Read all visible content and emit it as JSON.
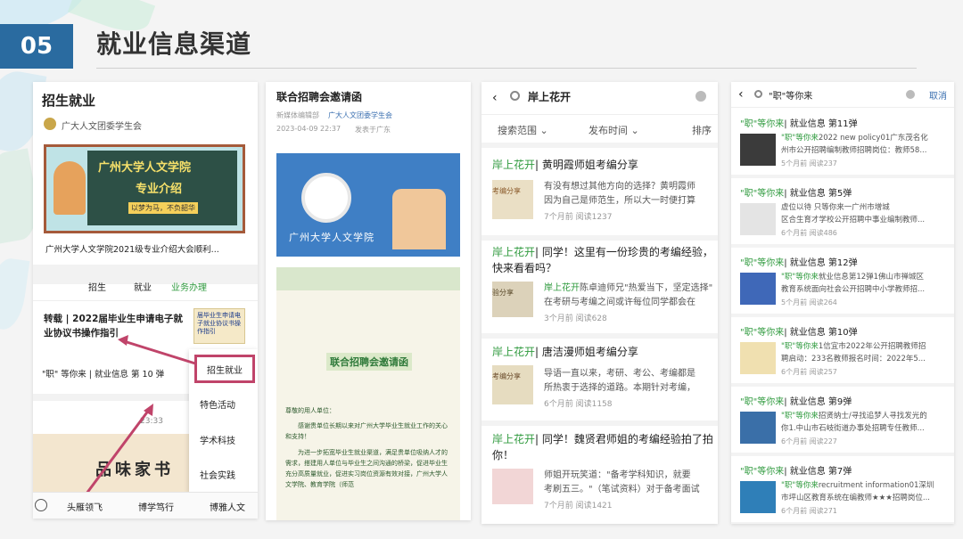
{
  "slide": {
    "number": "05",
    "title": "就业信息渠道"
  },
  "p1": {
    "title": "招生就业",
    "account": "广大人文团委学生会",
    "banner_line1": "广州大学人文学院",
    "banner_line2": "专业介绍",
    "banner_line3": "以梦为马，不负韶华",
    "article": "广州大学人文学院2021级专业介绍大会顺利...",
    "tabs": [
      "招生",
      "就业",
      "业务办理"
    ],
    "item1": "转载 | 2022届毕业生申请电子就业协议书操作指引",
    "thumb1": "届毕业生申请电子就业协议书操作指引",
    "item2": "\"职\" 等你来 | 就业信息 第 10 弹",
    "time": "23:33",
    "photo_text": "品味家书",
    "popup": [
      "招生就业",
      "特色活动",
      "学术科技",
      "社会实践"
    ],
    "bottom": [
      "头雁领飞",
      "博学笃行",
      "博雅人文"
    ]
  },
  "p2": {
    "title": "联合招聘会邀请函",
    "editor": "新媒体编辑部",
    "account": "广大人文团委学生会",
    "date": "2023-04-09 22:37",
    "place": "发表于广东",
    "school": "广州大学人文学院",
    "poster_title": "联合招聘会邀请函",
    "body": [
      "尊敬的用人单位：",
      "感谢贵单位长期以来对广州大学毕业生就业工作的关心和支持！",
      "为进一步拓宽毕业生就业渠道，满足贵单位吸纳人才的需求，搭建用人单位与毕业生之间沟通的桥梁，促进毕业生充分高质量就业，促进实习岗位资源有效对接，广州大学人文学院、教育学院（师范"
    ]
  },
  "p3": {
    "query": "岸上花开",
    "filter1": "搜索范围",
    "filter2": "发布时间",
    "filter3": "排序",
    "results": [
      {
        "title_tag": "岸上花开",
        "title": "| 黄明霞师姐考编分享",
        "line1": "有没有想过其他方向的选择？黄明霞师",
        "line2": "因为自己是师范生，所以大一时便打算",
        "meta": "7个月前   阅读1237",
        "thumb": "考编分享"
      },
      {
        "title_tag": "岸上花开",
        "title": "| 同学！这里有一份珍贵的考编经验，快来看看吗？",
        "line1_tag": "岸上花开",
        "line1": "陈卓迪师兄\"热爱当下，坚定选择\"",
        "line2": "在考研与考编之间或许每位同学都会在",
        "meta": "3个月前   阅读628",
        "thumb": "验分享"
      },
      {
        "title_tag": "岸上花开",
        "title": "| 唐洁漫师姐考编分享",
        "line1": "导语一直以来，考研、考公、考编都是",
        "line2": "所热衷于选择的道路。本期针对考编，",
        "meta": "6个月前   阅读1158",
        "thumb": "考编分享"
      },
      {
        "title_tag": "岸上花开",
        "title": "| 同学！魏贤君师姐的考编经验拍了拍你！",
        "line1": "师姐开玩笑道：\"备考学科知识，就要",
        "line2": "考刷五三。\"（笔试资料）对于备考面试",
        "meta": "7个月前   阅读1421",
        "thumb": ""
      }
    ]
  },
  "p4": {
    "query": "\"职\"等你来",
    "cancel": "取消",
    "results": [
      {
        "tag": "\"职\"等你来",
        "title": "| 就业信息 第11弹",
        "line1_tag": "\"职\"等你来",
        "line1": "2022 new policy01广东茂名化",
        "line2": "州市公开招聘编制教师招聘岗位：教师58...",
        "meta": "5个月前   阅读237"
      },
      {
        "tag": "\"职\"等你来",
        "title": "| 就业信息 第5弹",
        "line1": "虚位以待 只等你来一广州市增城",
        "line2": "区合生育才学校公开招聘中事业编制教师...",
        "meta": "6个月前   阅读486"
      },
      {
        "tag": "\"职\"等你来",
        "title": "| 就业信息 第12弹",
        "line1_tag": "\"职\"等你来",
        "line1": "就业信息第12弹1佛山市禅城区",
        "line2": "教育系统面向社会公开招聘中小学教师招...",
        "meta": "5个月前   阅读264"
      },
      {
        "tag": "\"职\"等你来",
        "title": "| 就业信息 第10弹",
        "line1_tag": "\"职\"等你来",
        "line1": "1信宜市2022年公开招聘教师招",
        "line2": "聘启动：233名教师报名时间：2022年5...",
        "meta": "6个月前   阅读257"
      },
      {
        "tag": "\"职\"等你来",
        "title": "| 就业信息 第9弹",
        "line1_tag": "\"职\"等你来",
        "line1": "招贤纳士/寻找追梦人寻找发光的",
        "line2": "你1.中山市石岐街道办事处招聘专任教师...",
        "meta": "6个月前   阅读227"
      },
      {
        "tag": "\"职\"等你来",
        "title": "| 就业信息 第7弹",
        "line1_tag": "\"职\"等你来",
        "line1": "recruitment information01深圳",
        "line2": "市坪山区教育系统在编教师★★★招聘岗位...",
        "meta": "6个月前   阅读271"
      }
    ]
  },
  "colors": {
    "accent_green": "#2f9a3e",
    "number_bg": "#2a6ba0",
    "highlight": "#c0446a"
  }
}
